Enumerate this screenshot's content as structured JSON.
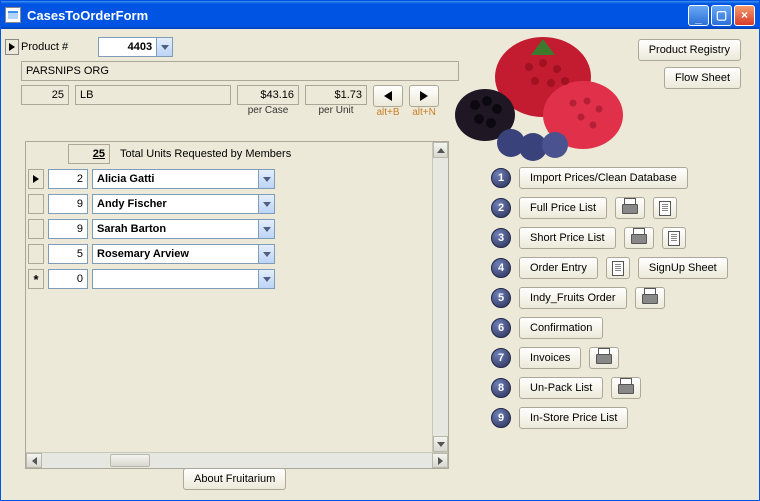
{
  "window": {
    "title": "CasesToOrderForm"
  },
  "top_buttons": {
    "registry": "Product Registry",
    "flow": "Flow Sheet"
  },
  "product": {
    "label": "Product #",
    "number": "4403",
    "name": "PARSNIPS ORG",
    "case_qty": "25",
    "unit": "LB",
    "per_case": "$43.16",
    "per_case_label": "per Case",
    "per_unit": "$1.73",
    "per_unit_label": "per Unit",
    "prev_hint": "alt+B",
    "next_hint": "alt+N"
  },
  "subform": {
    "total": "25",
    "total_label": "Total Units Requested by Members",
    "rows": [
      {
        "qty": "2",
        "name": "Alicia Gatti"
      },
      {
        "qty": "9",
        "name": "Andy Fischer"
      },
      {
        "qty": "9",
        "name": "Sarah Barton"
      },
      {
        "qty": "5",
        "name": "Rosemary Arview"
      }
    ],
    "new_qty": "0"
  },
  "side": {
    "items": [
      {
        "num": "1",
        "label": "Import Prices/Clean Database",
        "extras": []
      },
      {
        "num": "2",
        "label": "Full Price List",
        "extras": [
          "printer",
          "doc"
        ]
      },
      {
        "num": "3",
        "label": "Short Price List",
        "extras": [
          "printer",
          "doc"
        ]
      },
      {
        "num": "4",
        "label": "Order Entry",
        "extras": [
          "doc"
        ],
        "extra2": "SignUp Sheet"
      },
      {
        "num": "5",
        "label": "Indy_Fruits Order",
        "extras": [
          "printer"
        ]
      },
      {
        "num": "6",
        "label": "Confirmation",
        "extras": []
      },
      {
        "num": "7",
        "label": "Invoices",
        "extras": [
          "printer"
        ]
      },
      {
        "num": "8",
        "label": "Un-Pack List",
        "extras": [
          "printer"
        ]
      },
      {
        "num": "9",
        "label": "In-Store Price List",
        "extras": []
      }
    ]
  },
  "footer": {
    "about": "About Fruitarium"
  }
}
